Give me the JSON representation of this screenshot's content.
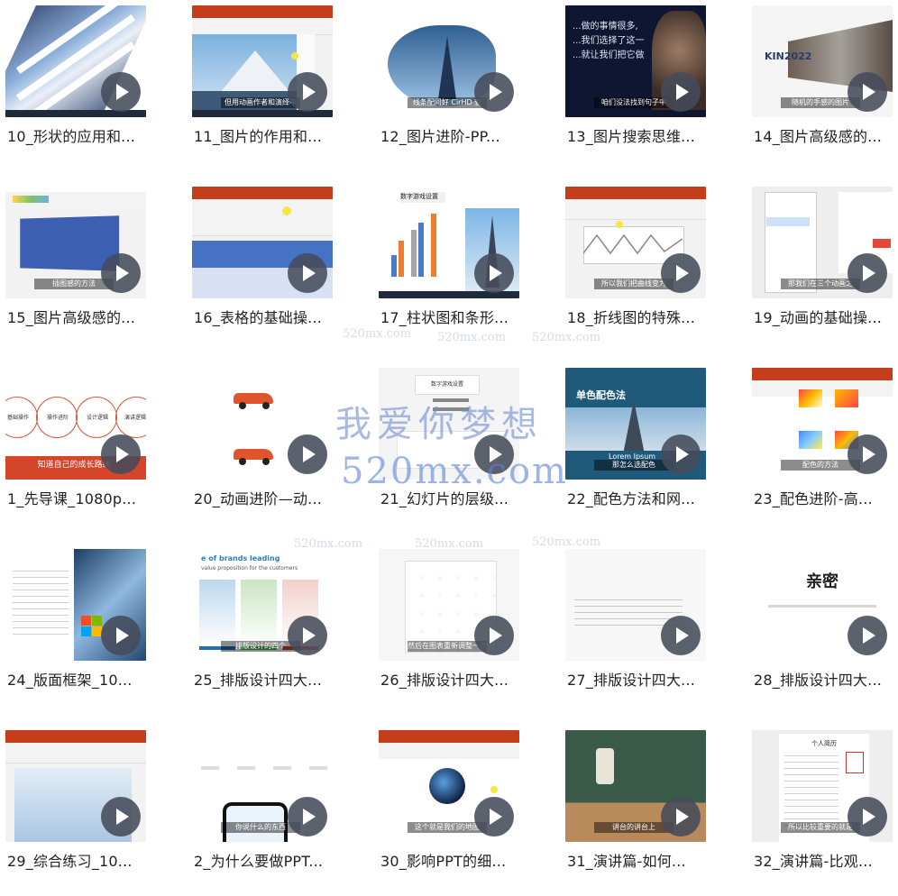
{
  "watermark": {
    "main_cn": "我爱你梦想",
    "main_en": "520mx.com",
    "small": "520mx.com"
  },
  "videos": [
    {
      "title": "10_形状的应用和...",
      "caption": ""
    },
    {
      "title": "11_图片的作用和...",
      "caption": "但用动画作者和演绎中"
    },
    {
      "title": "12_图片进阶-PP...",
      "caption": "线条配问好 CirHD 查"
    },
    {
      "title": "13_图片搜索思维...",
      "caption": "咱们没法找到句子中"
    },
    {
      "title": "14_图片高级感的...",
      "caption": "随机的手感的图片"
    },
    {
      "title": "15_图片高级感的...",
      "caption": "插图感的方法"
    },
    {
      "title": "16_表格的基础操...",
      "caption": ""
    },
    {
      "title": "17_柱状图和条形...",
      "caption": ""
    },
    {
      "title": "18_折线图的特殊...",
      "caption": "所以我们把曲线变为"
    },
    {
      "title": "19_动画的基础操...",
      "caption": "那我们在三个动画之"
    },
    {
      "title": "1_先导课_1080p...",
      "caption": "知道自己的成长路线"
    },
    {
      "title": "20_动画进阶—动...",
      "caption": ""
    },
    {
      "title": "21_幻灯片的层级...",
      "caption": ""
    },
    {
      "title": "22_配色方法和网...",
      "caption": "那怎么选配色"
    },
    {
      "title": "23_配色进阶-高...",
      "caption": "配色的方法"
    },
    {
      "title": "24_版面框架_10...",
      "caption": ""
    },
    {
      "title": "25_排版设计四大...",
      "caption": "排版设计的四个"
    },
    {
      "title": "26_排版设计四大...",
      "caption": "然后在图表重新调整一次"
    },
    {
      "title": "27_排版设计四大...",
      "caption": ""
    },
    {
      "title": "28_排版设计四大...",
      "caption": ""
    },
    {
      "title": "29_综合练习_10...",
      "caption": ""
    },
    {
      "title": "2_为什么要做PPT...",
      "caption": "你说什么的东西"
    },
    {
      "title": "30_影响PPT的细...",
      "caption": "这个就是我们的地图"
    },
    {
      "title": "31_演讲篇-如何...",
      "caption": "讲台的讲台上"
    },
    {
      "title": "32_演讲篇-比观...",
      "caption": "所以比较重要的就是"
    }
  ],
  "slide_text": {
    "t13": [
      "...做的事情很多,",
      "...我们选择了这一",
      "...就让我们把它做"
    ],
    "t14": "KIN2022",
    "t21": "数字游戏设置",
    "t22_title": "单色配色法",
    "t22_sub": "Lorem Ipsum",
    "t25_head": "e of brands leading",
    "t25_sub": "value proposition for the customers",
    "t28": "亲密",
    "t32": "个人简历",
    "t1_labels": [
      "基础操作",
      "操作进阶",
      "设计逻辑",
      "演讲逻辑"
    ]
  }
}
